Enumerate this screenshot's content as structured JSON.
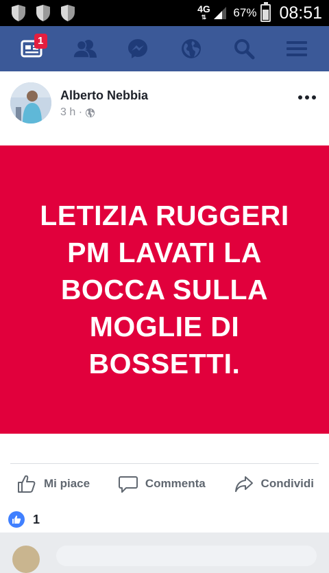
{
  "status_bar": {
    "network": "4G",
    "battery_percent": "67%",
    "battery_level": 0.67,
    "time": "08:51",
    "notification_icons": [
      "shield-icon",
      "shield-icon",
      "shield-icon"
    ]
  },
  "nav": {
    "items": [
      {
        "name": "news-feed",
        "icon": "news-feed-icon",
        "badge": "1"
      },
      {
        "name": "friend-requests",
        "icon": "friends-icon"
      },
      {
        "name": "messenger",
        "icon": "messenger-icon"
      },
      {
        "name": "notifications",
        "icon": "globe-icon"
      },
      {
        "name": "search",
        "icon": "search-icon"
      },
      {
        "name": "menu",
        "icon": "hamburger-menu-icon"
      }
    ],
    "color": "#3b5998"
  },
  "post": {
    "author": "Alberto Nebbia",
    "time": "3 h ·",
    "privacy_icon": "globe-icon",
    "banner_color": "#e1003c",
    "banner_lines": [
      "LETIZIA RUGGERI",
      "PM LAVATI LA",
      "BOCCA SULLA",
      "MOGLIE DI",
      "BOSSETTI."
    ],
    "actions": {
      "like": "Mi piace",
      "comment": "Commenta",
      "share": "Condividi"
    },
    "like_count": "1"
  }
}
